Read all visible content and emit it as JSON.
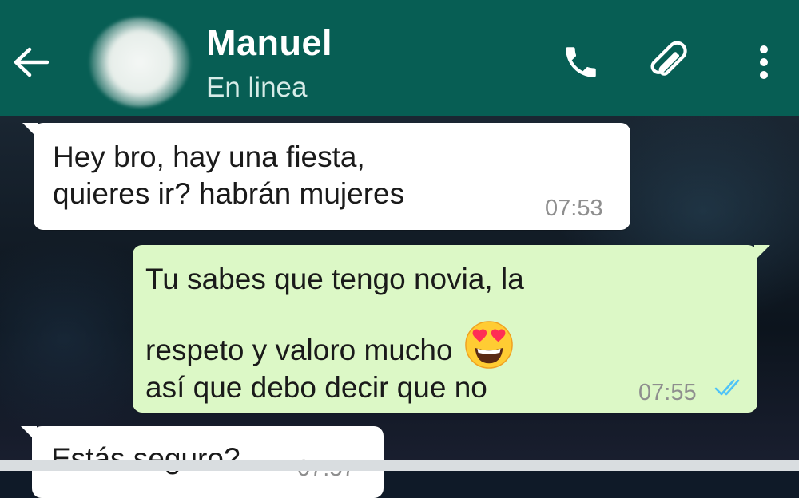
{
  "header": {
    "contact_name": "Manuel",
    "status": "En linea",
    "icons": [
      "back-arrow-icon",
      "phone-icon",
      "paperclip-icon",
      "more-vert-icon"
    ],
    "color": "#075e54"
  },
  "messages": [
    {
      "direction": "incoming",
      "lines": [
        "Hey bro, hay una fiesta,",
        "quieres ir? habrán mujeres"
      ],
      "time": "07:53"
    },
    {
      "direction": "outgoing",
      "lines": [
        "Tu sabes que tengo novia, la",
        "respeto y valoro mucho",
        "así que debo decir que no"
      ],
      "emoji": "heart-eyes-emoji",
      "time": "07:55",
      "status": "read"
    },
    {
      "direction": "incoming",
      "lines": [
        "Estás seguro?"
      ],
      "time": "07:57"
    }
  ],
  "colors": {
    "incoming_bubble": "#ffffff",
    "outgoing_bubble": "#dcf8c6",
    "read_ticks": "#4fc3f7"
  }
}
